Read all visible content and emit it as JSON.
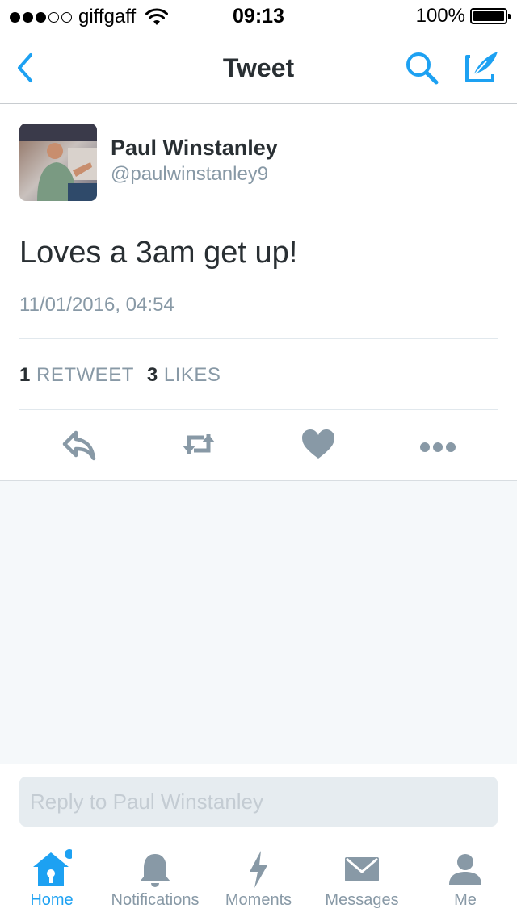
{
  "status_bar": {
    "carrier": "giffgaff",
    "time": "09:13",
    "battery": "100%",
    "signal_bars_filled": 3,
    "signal_bars_total": 5
  },
  "nav": {
    "title": "Tweet",
    "back_icon": "chevron-left-icon",
    "search_icon": "search-icon",
    "compose_icon": "compose-tweet-icon"
  },
  "tweet": {
    "author_name": "Paul Winstanley",
    "author_handle": "@paulwinstanley9",
    "text": "Loves a 3am get up!",
    "timestamp": "11/01/2016, 04:54",
    "retweet_count": "1",
    "retweet_label": "RETWEET",
    "like_count": "3",
    "like_label": "LIKES"
  },
  "actions": [
    "reply-icon",
    "retweet-icon",
    "like-icon",
    "more-icon"
  ],
  "reply": {
    "placeholder": "Reply to Paul Winstanley"
  },
  "tabs": [
    {
      "label": "Home",
      "icon": "home-icon",
      "active": true
    },
    {
      "label": "Notifications",
      "icon": "bell-icon",
      "active": false
    },
    {
      "label": "Moments",
      "icon": "lightning-icon",
      "active": false
    },
    {
      "label": "Messages",
      "icon": "envelope-icon",
      "active": false
    },
    {
      "label": "Me",
      "icon": "person-icon",
      "active": false
    }
  ],
  "colors": {
    "accent": "#1da1f2",
    "icon_gray": "#8899a6",
    "text": "#292f33",
    "background_gray": "#f5f8fa"
  }
}
